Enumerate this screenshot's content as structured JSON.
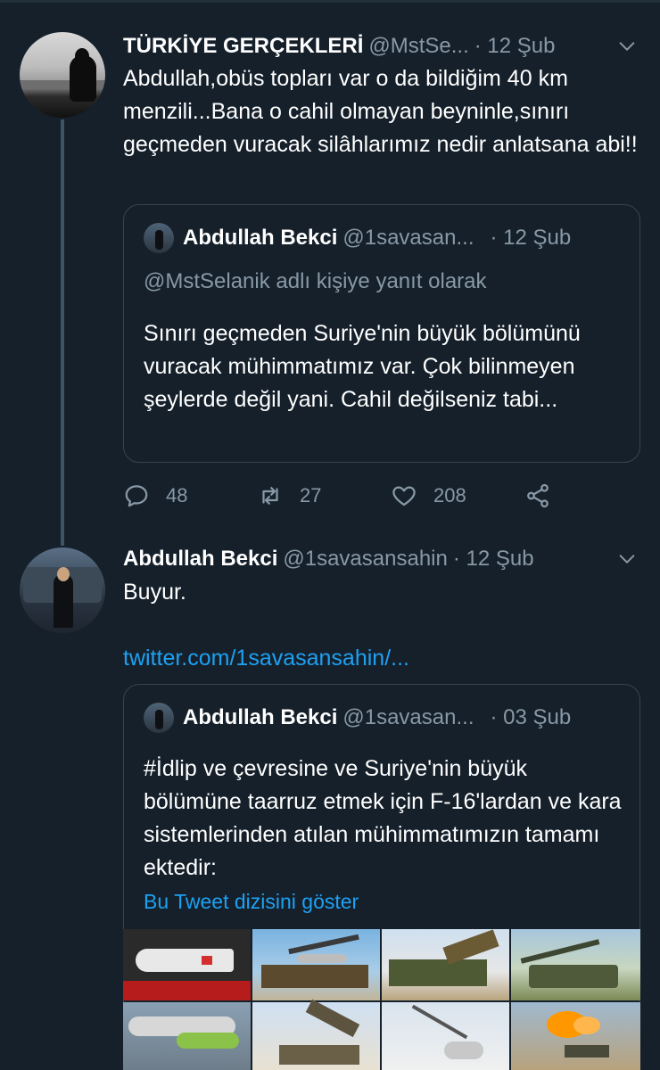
{
  "tweet1": {
    "name": "TÜRKİYE GERÇEKLERİ",
    "handle": "@MstSe...",
    "date": "· 12 Şub",
    "text": "Abdullah,obüs topları var o da bildiğim 40 km menzili...Bana o cahil olmayan beyninle,sınırı geçmeden vuracak silâhlarımız nedir anlatsana abi!!",
    "quote": {
      "name": "Abdullah Bekci",
      "handle": "@1savasan...",
      "date": "· 12 Şub",
      "reply_to": "@MstSelanik adlı kişiye yanıt olarak",
      "text": "Sınırı geçmeden Suriye'nin büyük bölümünü vuracak mühimmatımız var. Çok bilinmeyen şeylerde değil yani. Cahil değilseniz tabi..."
    },
    "actions": {
      "replies": "48",
      "retweets": "27",
      "likes": "208"
    }
  },
  "tweet2": {
    "name": "Abdullah Bekci",
    "handle": "@1savasansahin",
    "date": "· 12 Şub",
    "text": "Buyur.",
    "link": "twitter.com/1savasansahin/...",
    "quote": {
      "name": "Abdullah Bekci",
      "handle": "@1savasan...",
      "date": "· 03 Şub",
      "text": "#İdlip ve çevresine ve Suriye'nin büyük bölümüne taarruz etmek için F-16'lardan ve kara sistemlerinden atılan mühimmatımızın tamamı ektedir:",
      "show_thread": "Bu Tweet dizisini göster"
    }
  },
  "colors": {
    "background": "#15202b",
    "border": "#38444d",
    "muted": "#8899a6",
    "link": "#1da1f2",
    "thread_line": "#3d5466"
  }
}
